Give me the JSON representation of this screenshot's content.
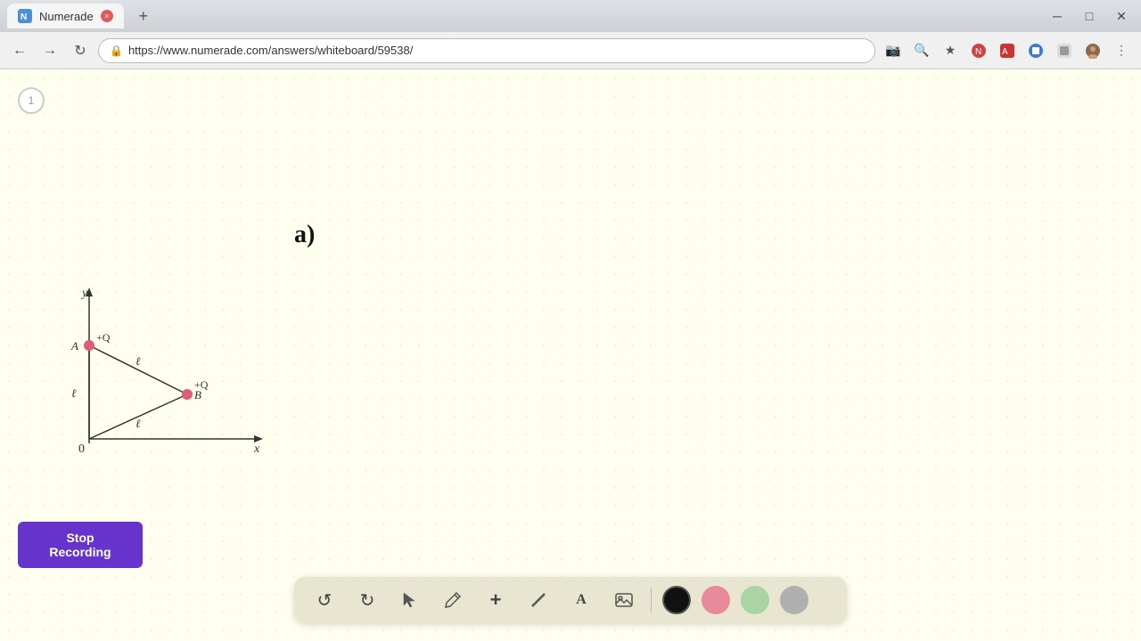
{
  "browser": {
    "tab_title": "Numerade",
    "tab_close_label": "×",
    "new_tab_label": "+",
    "url": "https://www.numerade.com/answers/whiteboard/59538/",
    "window_minimize": "─",
    "window_restore": "□",
    "window_close": "✕"
  },
  "nav": {
    "back_label": "←",
    "forward_label": "→",
    "refresh_label": "↻",
    "address_icon": "🔒"
  },
  "whiteboard": {
    "page_number": "1",
    "math_label": "a)",
    "diagram": {
      "y_axis_label": "y",
      "x_axis_label": "x",
      "origin_label": "0",
      "point_a_label": "A",
      "point_b_label": "B",
      "charge_top_label": "+Q",
      "charge_right_label": "+Q",
      "side_label_left": "ℓ",
      "side_label_top": "ℓ",
      "side_label_bottom": "ℓ"
    }
  },
  "toolbar": {
    "undo_label": "↺",
    "redo_label": "↻",
    "select_label": "▲",
    "pen_label": "✎",
    "add_label": "+",
    "eraser_label": "/",
    "text_label": "A",
    "image_label": "🖼",
    "stop_recording_label": "Stop Recording",
    "colors": {
      "black": "#111111",
      "pink": "#e88a9a",
      "green": "#a8d5a2",
      "gray": "#b0b0b0"
    }
  }
}
